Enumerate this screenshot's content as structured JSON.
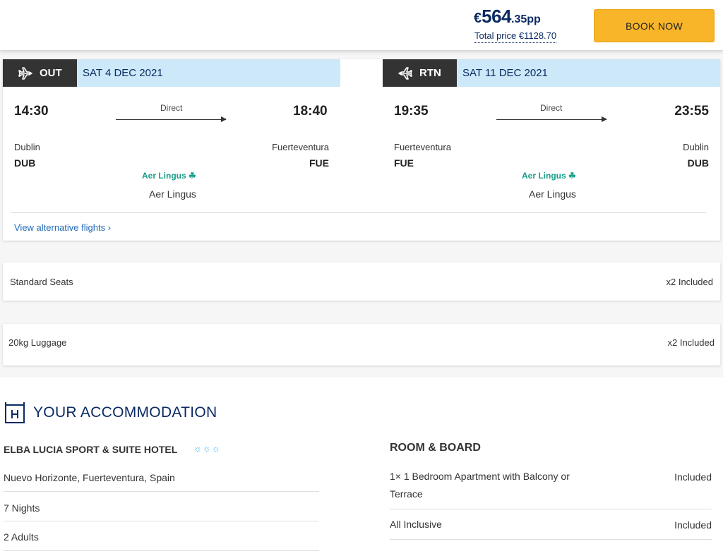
{
  "header": {
    "price_currency": "€",
    "price_main": "564",
    "price_fraction": ".35pp",
    "total_price": "Total price €1128.70",
    "book_label": "BOOK NOW"
  },
  "flights": {
    "out": {
      "tag": "OUT",
      "date": "SAT 4 DEC 2021",
      "depart_time": "14:30",
      "arrive_time": "18:40",
      "stops": "Direct",
      "from_city": "Dublin",
      "from_code": "DUB",
      "to_city": "Fuerteventura",
      "to_code": "FUE",
      "airline_logo": "Aer Lingus",
      "airline": "Aer Lingus"
    },
    "rtn": {
      "tag": "RTN",
      "date": "SAT 11 DEC 2021",
      "depart_time": "19:35",
      "arrive_time": "23:55",
      "stops": "Direct",
      "from_city": "Fuerteventura",
      "from_code": "FUE",
      "to_city": "Dublin",
      "to_code": "DUB",
      "airline_logo": "Aer Lingus",
      "airline": "Aer Lingus"
    },
    "alternative_link": "View alternative flights ›"
  },
  "extras": [
    {
      "label": "Standard Seats",
      "status": "x2 Included"
    },
    {
      "label": "20kg Luggage",
      "status": "x2 Included"
    }
  ],
  "accommodation": {
    "title": "YOUR ACCOMMODATION",
    "hotel_name": "ELBA LUCIA SPORT & SUITE HOTEL",
    "stars": "☼☼☼",
    "location": "Nuevo Horizonte, Fuerteventura, Spain",
    "nights": "7 Nights",
    "guests": "2 Adults",
    "room_board_title": "ROOM & BOARD",
    "room": "1× 1 Bedroom Apartment with Balcony or Terrace",
    "room_status": "Included",
    "board": "All Inclusive",
    "board_status": "Included"
  },
  "colors": {
    "brand_navy": "#0b2a63",
    "book_button": "#f8b529",
    "date_bar": "#cde8f8",
    "link": "#1e6bb8"
  }
}
